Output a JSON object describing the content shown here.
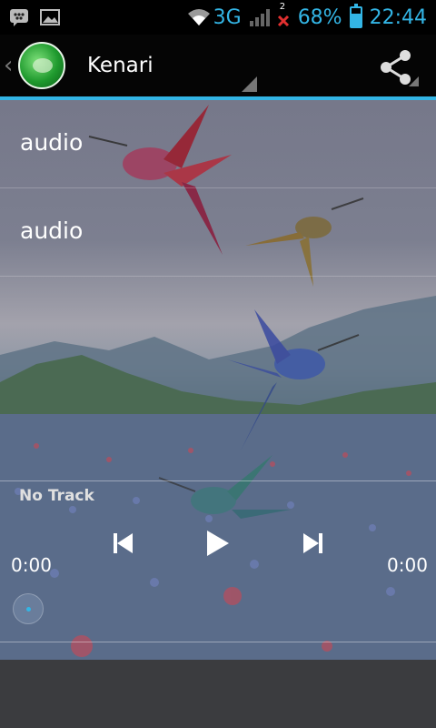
{
  "status_bar": {
    "network": "3G",
    "notification_count": "2",
    "battery_percent": "68%",
    "battery_level": 0.68,
    "time": "22:44",
    "icons": [
      "bbm-icon",
      "gallery-icon",
      "wifi-icon",
      "signal-icon",
      "missed-call-icon",
      "battery-icon"
    ]
  },
  "action_bar": {
    "title": "Kenari",
    "up_icon": "chevron-left-icon",
    "share_icon": "share-icon"
  },
  "playlist": {
    "items": [
      {
        "label": "audio"
      },
      {
        "label": "audio"
      }
    ]
  },
  "player": {
    "track_title": "No Track",
    "elapsed": "0:00",
    "duration": "0:00",
    "progress": 0,
    "controls": [
      "previous-icon",
      "play-icon",
      "next-icon"
    ]
  },
  "colors": {
    "accent": "#33b5e5",
    "action_bar_bg": "#050505",
    "bottom_bar_bg": "#3b3c3f"
  }
}
